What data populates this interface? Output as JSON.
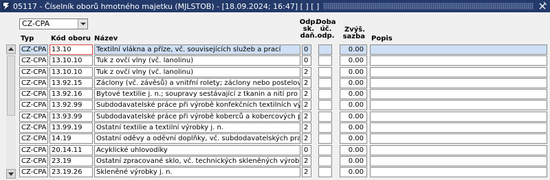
{
  "window": {
    "title": "05117 - Číselník oborů hmotného majetku (MJLSTOB) - [18.09.2024; 16:47]  [ ]  [ ]"
  },
  "filter": {
    "selected": "CZ-CPA"
  },
  "columns": {
    "typ": "Typ",
    "kod": "Kód oboru",
    "nazev": "Název",
    "odp_sk_dan": [
      "Odp.",
      "sk.",
      "daň."
    ],
    "doba_uc_odp": [
      "Doba",
      "úč.",
      "odp."
    ],
    "zvys_sazba": [
      "Zvýš.",
      "sazba"
    ],
    "popis": "Popis"
  },
  "rows": [
    {
      "typ": "CZ-CPA",
      "kod": "13.10",
      "nazev": "Textilní vlákna a příze, vč. souvisejících služeb a prací",
      "dan": "0",
      "doba": "",
      "sazba": "0.00",
      "popis": ""
    },
    {
      "typ": "CZ-CPA",
      "kod": "13.10.10",
      "nazev": "Tuk z ovčí vlny (vč. lanolinu)",
      "dan": "0",
      "doba": "",
      "sazba": "0.00",
      "popis": ""
    },
    {
      "typ": "CZ-CPA",
      "kod": "13.10.10",
      "nazev": "Tuk z ovčí vlny (vč. lanolinu)",
      "dan": "2",
      "doba": "",
      "sazba": "0.00",
      "popis": ""
    },
    {
      "typ": "CZ-CPA",
      "kod": "13.92.15",
      "nazev": "Záclony (vč. závěsů) a vnitřní rolety; záclony nebo postelové draperie",
      "dan": "2",
      "doba": "",
      "sazba": "0.00",
      "popis": ""
    },
    {
      "typ": "CZ-CPA",
      "kod": "13.92.16",
      "nazev": "Bytové textilie j. n.; soupravy sestávající z tkanin a nití pro výrobu koberc",
      "dan": "2",
      "doba": "",
      "sazba": "0.00",
      "popis": ""
    },
    {
      "typ": "CZ-CPA",
      "kod": "13.92.99",
      "nazev": "Subdodavatelské práce při výrobě konfekčních textilních výrobků, krom",
      "dan": "2",
      "doba": "",
      "sazba": "0.00",
      "popis": ""
    },
    {
      "typ": "CZ-CPA",
      "kod": "13.93.99",
      "nazev": "Subdodavatelské práce při výrobě koberců a kobercových předložek",
      "dan": "2",
      "doba": "",
      "sazba": "0.00",
      "popis": ""
    },
    {
      "typ": "CZ-CPA",
      "kod": "13.99.19",
      "nazev": "Ostatní textilie a textilní výrobky j. n.",
      "dan": "2",
      "doba": "",
      "sazba": "0.00",
      "popis": ""
    },
    {
      "typ": "CZ-CPA",
      "kod": "14.19",
      "nazev": "Ostatní oděvy a oděvní doplňky, vč. subdodavatelských prací",
      "dan": "2",
      "doba": "",
      "sazba": "0.00",
      "popis": ""
    },
    {
      "typ": "CZ-CPA",
      "kod": "20.14.11",
      "nazev": "Acyklické uhlovodíky",
      "dan": "0",
      "doba": "",
      "sazba": "0.00",
      "popis": ""
    },
    {
      "typ": "CZ-CPA",
      "kod": "23.19",
      "nazev": "Ostatní zpracované sklo, vč. technických skleněných výrobků a souvise",
      "dan": "2",
      "doba": "",
      "sazba": "0.00",
      "popis": ""
    },
    {
      "typ": "CZ-CPA",
      "kod": "23.19.26",
      "nazev": "Skleněné výrobky j. n.",
      "dan": "2",
      "doba": "",
      "sazba": "0.00",
      "popis": ""
    }
  ],
  "selected_row": 0,
  "icons": {
    "app": "app-logo-icon",
    "close": "close-icon",
    "up": "scroll-up-icon",
    "down": "scroll-down-icon",
    "dropdown": "chevron-down-icon"
  },
  "colors": {
    "titlebar": "#233a6a",
    "selected_row": "#cfe0f5",
    "focus_border": "#e04040"
  }
}
